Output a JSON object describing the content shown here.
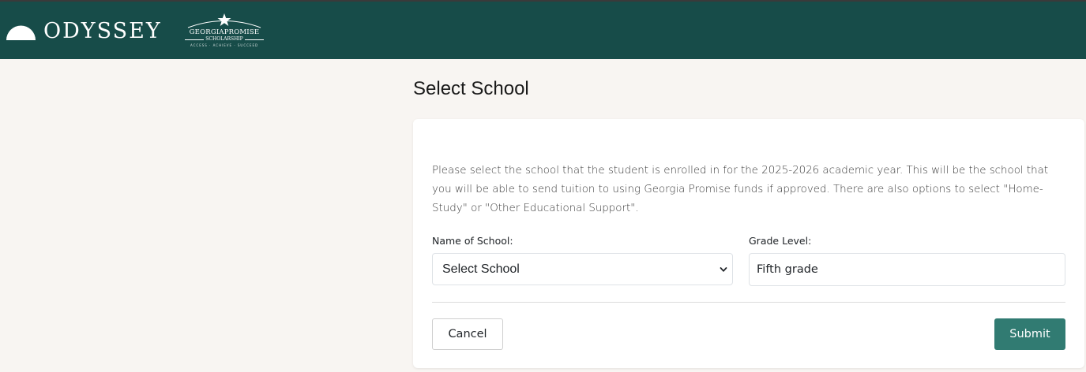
{
  "header": {
    "brand_name": "ODYSSEY",
    "partner_logo": {
      "title": "GEORGIAPROMISE",
      "subtitle": "SCHOLARSHIP",
      "tagline": "ACCESS · ACHIEVE · SUCCEED"
    },
    "icons": [
      "dome-icon",
      "star-icon"
    ],
    "colors": {
      "header_bg": "#174c49",
      "page_bg": "#f8f5f2",
      "accent": "#317b72"
    }
  },
  "page": {
    "title": "Select School",
    "intro": "Please select the school that the student is enrolled in for the 2025-2026 academic year. This will be the school that you will be able to send tuition to using Georgia Promise funds if approved. There are also options to select \"Home-Study\" or \"Other Educational Support\"."
  },
  "form": {
    "school": {
      "label": "Name of School:",
      "selected": "Select School"
    },
    "grade": {
      "label": "Grade Level:",
      "value": "Fifth grade"
    }
  },
  "actions": {
    "cancel_label": "Cancel",
    "submit_label": "Submit"
  }
}
